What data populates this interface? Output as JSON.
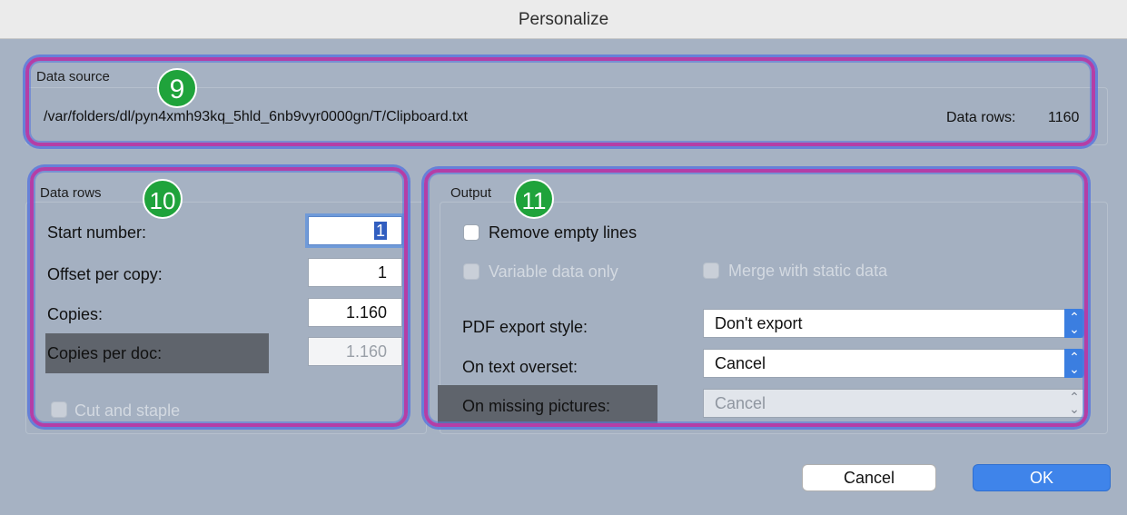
{
  "window": {
    "title": "Personalize"
  },
  "data_source": {
    "group_label": "Data source",
    "path": "/var/folders/dl/pyn4xmh93kq_5hld_6nb9vyr0000gn/T/Clipboard.txt",
    "rows_label": "Data rows:",
    "rows_value": "1160"
  },
  "data_rows": {
    "group_label": "Data rows",
    "start_number_label": "Start number:",
    "start_number_value": "1",
    "offset_label": "Offset per copy:",
    "offset_value": "1",
    "copies_label": "Copies:",
    "copies_value": "1.160",
    "copies_per_doc_label": "Copies per doc:",
    "copies_per_doc_value": "1.160",
    "cut_staple_label": "Cut and staple"
  },
  "output": {
    "group_label": "Output",
    "remove_empty_label": "Remove empty lines",
    "variable_only_label": "Variable data only",
    "merge_static_label": "Merge with static data",
    "pdf_export_label": "PDF export style:",
    "pdf_export_value": "Don't export",
    "text_overset_label": "On text overset:",
    "text_overset_value": "Cancel",
    "missing_pictures_label": "On missing pictures:",
    "missing_pictures_value": "Cancel"
  },
  "buttons": {
    "cancel": "Cancel",
    "ok": "OK"
  },
  "annotations": {
    "badge_9": "9",
    "badge_10": "10",
    "badge_11": "11"
  },
  "colors": {
    "accent": "#3f84ea",
    "annotation_border": "#b43ea6",
    "badge": "#1fa33b"
  }
}
